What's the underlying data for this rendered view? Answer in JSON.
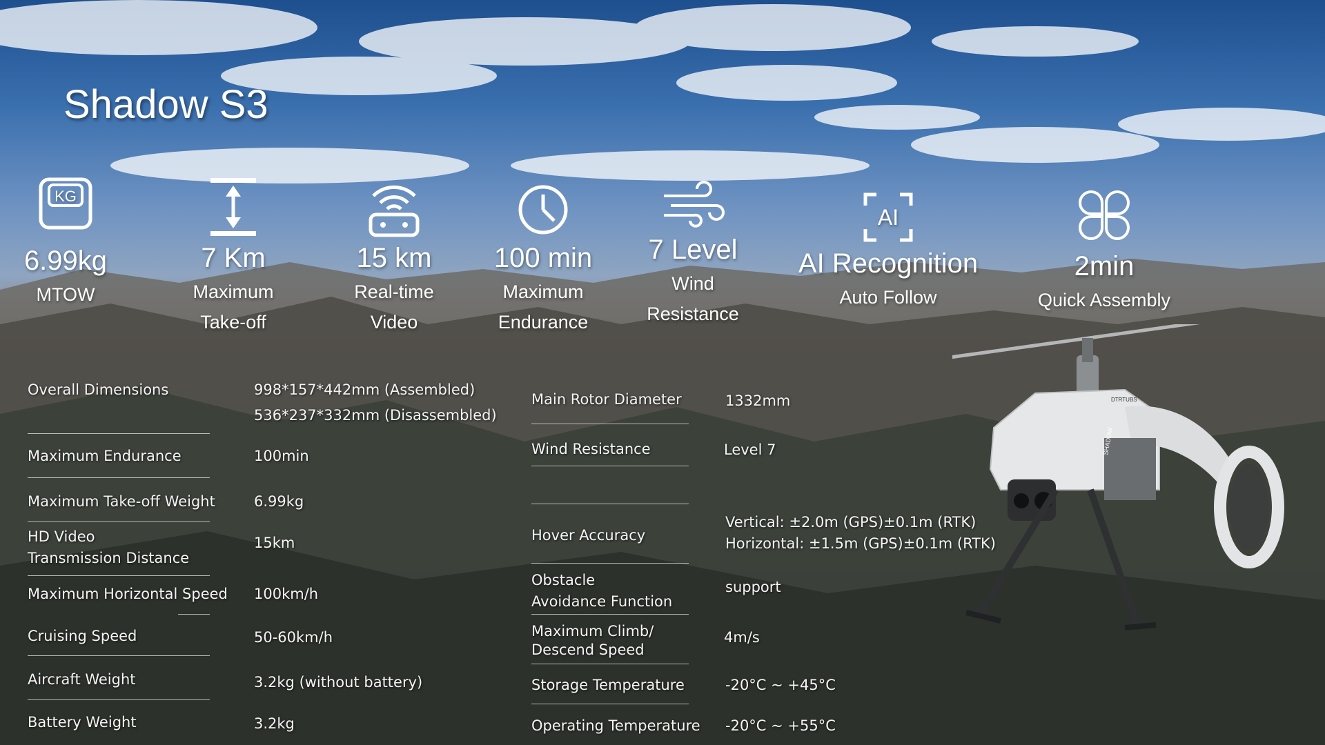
{
  "title": "Shadow S3",
  "stats": [
    {
      "icon": "kg-weight-icon",
      "value": "6.99kg",
      "label": "MTOW"
    },
    {
      "icon": "height-arrow-icon",
      "value": "7 Km",
      "label_line1": "Maximum",
      "label_line2": "Take-off"
    },
    {
      "icon": "wifi-transmitter-icon",
      "value": "15 km",
      "label_line1": "Real-time",
      "label_line2": "Video"
    },
    {
      "icon": "clock-icon",
      "value": "100 min",
      "label_line1": "Maximum",
      "label_line2": "Endurance"
    },
    {
      "icon": "wind-icon",
      "value": "7 Level",
      "label_line1": "Wind",
      "label_line2": "Resistance"
    },
    {
      "icon": "ai-recognition-icon",
      "value": "AI Recognition",
      "label": "Auto Follow"
    },
    {
      "icon": "quadcopter-icon",
      "value": "2min",
      "label": "Quick Assembly"
    }
  ],
  "specs_left": [
    {
      "name": "Overall Dimensions",
      "value_line1": "998*157*442mm (Assembled)",
      "value_line2": "536*237*332mm (Disassembled)"
    },
    {
      "name": "Maximum Endurance",
      "value": "100min"
    },
    {
      "name": "Maximum Take-off Weight",
      "value": "6.99kg"
    },
    {
      "name_line1": "HD Video",
      "name_line2": "Transmission Distance",
      "value": "15km"
    },
    {
      "name": "Maximum Horizontal Speed",
      "value": "100km/h"
    },
    {
      "name": "Cruising Speed",
      "value": "50-60km/h"
    },
    {
      "name": "Aircraft Weight",
      "value": "3.2kg (without battery)"
    },
    {
      "name": "Battery Weight",
      "value": "3.2kg"
    }
  ],
  "specs_right": [
    {
      "name": "Main Rotor Diameter",
      "value": "1332mm"
    },
    {
      "name": "Wind Resistance",
      "value": "Level 7"
    },
    {
      "name": "Hover Accuracy",
      "value_line1": "Vertical: ±2.0m (GPS)±0.1m (RTK)",
      "value_line2": "Horizontal: ±1.5m (GPS)±0.1m (RTK)"
    },
    {
      "name_line1": "Obstacle",
      "name_line2": "Avoidance Function",
      "value": "support"
    },
    {
      "name_line1": "Maximum Climb/",
      "name_line2": "Descend Speed",
      "value": "4m/s"
    },
    {
      "name": "Storage Temperature",
      "value": "-20°C ~ +45°C"
    },
    {
      "name": "Operating Temperature",
      "value": "-20°C ~ +55°C"
    }
  ],
  "drone": {
    "brand_mark": "SHADOW",
    "logo_mark": "DTRTUBS"
  }
}
